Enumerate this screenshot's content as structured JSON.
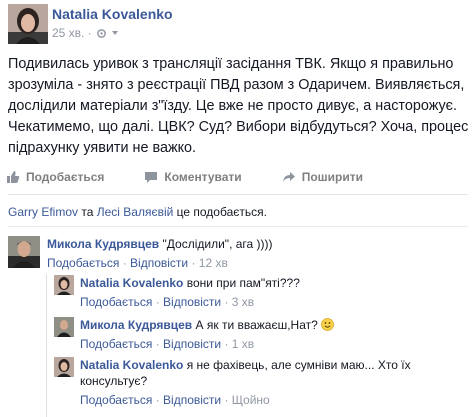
{
  "post": {
    "author": "Natalia Kovalenko",
    "time": "25 хв. ·",
    "text": "Подивилась уривок з трансляції засідання ТВК. Якщо я правильно зрозуміла - знято з реєстрації ПВД разом з Одаричем. Виявляється, дослідили матеріали з\"їзду. Це вже не просто дивує, а насторожує. Чекатимемо, що далі. ЦВК? Суд? Вибори відбудуться? Хоча, процес підрахунку уявити не важко."
  },
  "actions": {
    "like": "Подобається",
    "comment": "Коментувати",
    "share": "Поширити"
  },
  "likes": {
    "person1": "Garry Efimov",
    "and": " та ",
    "person2": "Лесі Валяєвій",
    "suffix": " це подобається."
  },
  "comments": [
    {
      "name": "Микола Кудрявцев",
      "text": "\"Дослідили\", ага ))))",
      "like": "Подобається",
      "reply": "Відповісти",
      "time": "12 хв"
    }
  ],
  "replies": [
    {
      "name": "Natalia Kovalenko",
      "text": "вони при пам\"яті???",
      "like": "Подобається",
      "reply": "Відповісти",
      "time": "3 хв"
    },
    {
      "name": "Микола Кудрявцев",
      "text": "А як ти вважаєш,Нат?",
      "like": "Подобається",
      "reply": "Відповісти",
      "time": "1 хв"
    },
    {
      "name": "Natalia Kovalenko",
      "text": "я не фахівець, але сумніви маю... Хто їх консультує?",
      "like": "Подобається",
      "reply": "Відповісти",
      "time": "Щойно"
    }
  ],
  "sep": " · ",
  "colors": {
    "link": "#3b5998",
    "meta": "#9197a3",
    "action": "#7f7f7f"
  },
  "icons": [
    "gear-icon",
    "caret-down-icon",
    "like-icon",
    "comment-icon",
    "share-icon",
    "smiley-icon"
  ]
}
